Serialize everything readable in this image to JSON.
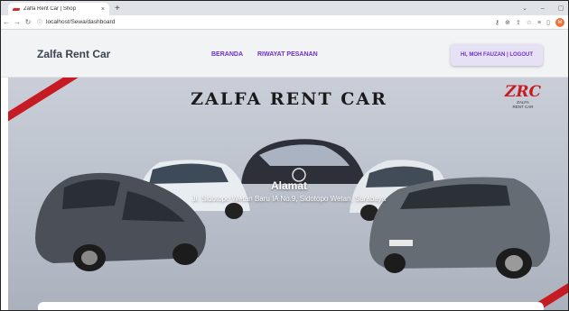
{
  "browser": {
    "tab_title": "Zalfa Rent Car | Shop",
    "tab_close": "×",
    "new_tab": "+",
    "url": "localhost/Sewa/dashboard",
    "profile_initial": "M",
    "window_controls": [
      "⌄",
      "–",
      "▢"
    ]
  },
  "navbar": {
    "brand": "Zalfa Rent Car",
    "menu": [
      {
        "label": "BERANDA"
      },
      {
        "label": "RIWAYAT PESANAN"
      }
    ],
    "user_button": "HI, MOH FAUZAN | LOGOUT"
  },
  "hero": {
    "title": "ZALFA RENT CAR",
    "logo_mark": "ZRC",
    "logo_sub_1": "ZALFA",
    "logo_sub_2": "RENT CAR",
    "address_heading": "Alamat",
    "address_text": "Jl. Sidotopo Wetan Baru IA No.9, Sidotopo Wetan, Surabaya"
  },
  "colors": {
    "accent": "#6f2fc9",
    "brand_red": "#c71b23"
  }
}
